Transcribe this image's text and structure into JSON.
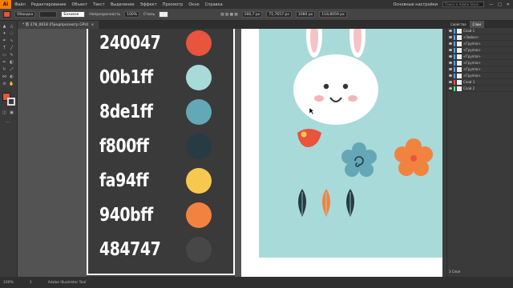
{
  "menu": {
    "logo": "Ai",
    "items": [
      "Файл",
      "Редактирование",
      "Объект",
      "Текст",
      "Выделение",
      "Эффект",
      "Просмотр",
      "Окно",
      "Справка"
    ],
    "workspace": "Основные настройки",
    "search_placeholder": "Поиск в Adobe Stock"
  },
  "control": {
    "mode": "Обводка",
    "stroke_style": "Базовая",
    "opacity_label": "Непрозрачность",
    "opacity_value": "100%",
    "style_label": "Стиль",
    "x": "166,7 px",
    "y": "71,7657 px",
    "w": "1080 px",
    "h": "118,8059 px"
  },
  "document_tab": {
    "name": "* 怒 278_0618 (Предпросмотр GPU)",
    "close": "×"
  },
  "palette": [
    {
      "label": "240047",
      "color": "#e8543c"
    },
    {
      "label": "00b1ff",
      "color": "#a8dad9"
    },
    {
      "label": "8de1ff",
      "color": "#64a7b6"
    },
    {
      "label": "f800ff",
      "color": "#263b44"
    },
    {
      "label": "fa94ff",
      "color": "#f7c84f"
    },
    {
      "label": "940bff",
      "color": "#f2833f"
    },
    {
      "label": "484747",
      "color": "#484747"
    }
  ],
  "panel": {
    "tabs": [
      "Свойства",
      "Слои"
    ],
    "layers": [
      {
        "name": "Слой 1",
        "color": "#4aa3ff"
      },
      {
        "name": "<Зайка>",
        "color": "#4aa3ff"
      },
      {
        "name": "<Группа>",
        "color": "#4aa3ff"
      },
      {
        "name": "<Группа>",
        "color": "#4aa3ff"
      },
      {
        "name": "<Группа>",
        "color": "#4aa3ff"
      },
      {
        "name": "<Группа>",
        "color": "#4aa3ff"
      },
      {
        "name": "<Группа>",
        "color": "#4aa3ff"
      },
      {
        "name": "<Группа>",
        "color": "#4aa3ff"
      },
      {
        "name": "Слой 3",
        "color": "#ff4a4a"
      },
      {
        "name": "Слой 2",
        "color": "#4aff6a"
      }
    ],
    "footer": "3 Слоя"
  },
  "status": {
    "zoom": "100%",
    "selection": "Adobe Illustrator Tool",
    "artboard": "1"
  }
}
